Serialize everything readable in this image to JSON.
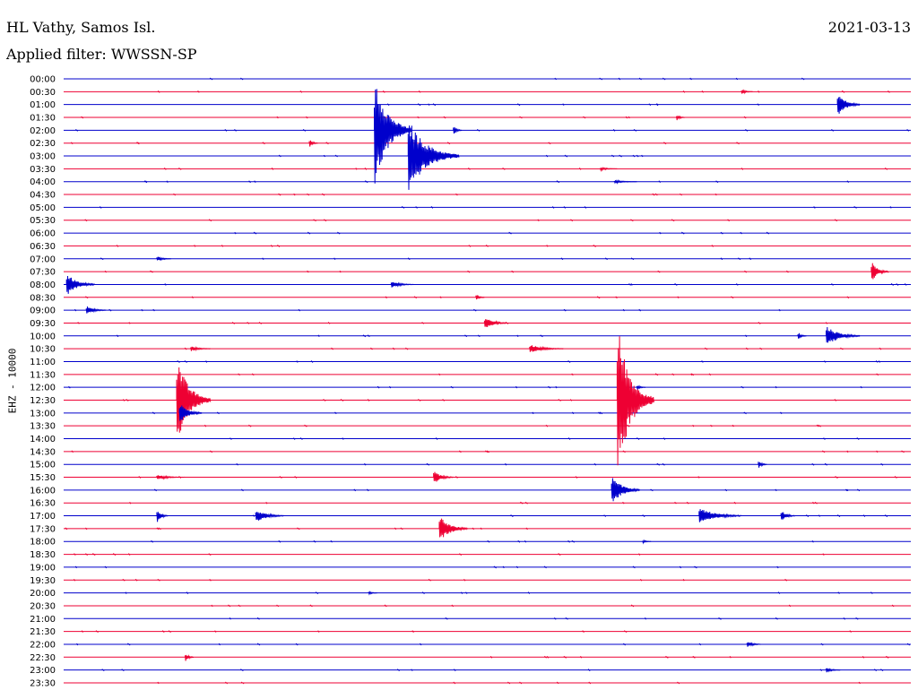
{
  "header": {
    "station": "HL Vathy, Samos Isl.",
    "date": "2021-03-13",
    "filter": "Applied filter: WWSSN-SP"
  },
  "chart_data": {
    "type": "line",
    "title": "HL Vathy, Samos Isl.",
    "subtitle": "Applied filter: WWSSN-SP",
    "ylabel": "EHZ - 10000",
    "trace_colors": [
      "#0000cc",
      "#ee0033"
    ],
    "row_times": [
      "00:00",
      "00:30",
      "01:00",
      "01:30",
      "02:00",
      "02:30",
      "03:00",
      "03:30",
      "04:00",
      "04:30",
      "05:00",
      "05:30",
      "06:00",
      "06:30",
      "07:00",
      "07:30",
      "08:00",
      "08:30",
      "09:00",
      "09:30",
      "10:00",
      "10:30",
      "11:00",
      "11:30",
      "12:00",
      "12:30",
      "13:00",
      "13:30",
      "14:00",
      "14:30",
      "15:00",
      "15:30",
      "16:00",
      "16:30",
      "17:00",
      "17:30",
      "18:00",
      "18:30",
      "19:00",
      "19:30",
      "20:00",
      "20:30",
      "21:00",
      "21:30",
      "22:00",
      "22:30",
      "23:00",
      "23:30"
    ],
    "x_minutes_range": [
      0,
      30
    ],
    "events": [
      {
        "row": 1,
        "minute": 24.0,
        "amp": 3,
        "dur": 0.4
      },
      {
        "row": 2,
        "minute": 27.4,
        "amp": 14,
        "dur": 0.8
      },
      {
        "row": 3,
        "minute": 21.7,
        "amp": 4,
        "dur": 0.3
      },
      {
        "row": 4,
        "minute": 11.0,
        "amp": 67,
        "dur": 1.3
      },
      {
        "row": 4,
        "minute": 13.8,
        "amp": 6,
        "dur": 0.3
      },
      {
        "row": 5,
        "minute": 8.7,
        "amp": 5,
        "dur": 0.3
      },
      {
        "row": 6,
        "minute": 12.2,
        "amp": 43,
        "dur": 1.8
      },
      {
        "row": 7,
        "minute": 19.0,
        "amp": 2,
        "dur": 0.6
      },
      {
        "row": 8,
        "minute": 19.5,
        "amp": 2,
        "dur": 0.8
      },
      {
        "row": 14,
        "minute": 3.3,
        "amp": 3,
        "dur": 0.5
      },
      {
        "row": 15,
        "minute": 28.6,
        "amp": 12,
        "dur": 0.6
      },
      {
        "row": 16,
        "minute": 0.1,
        "amp": 13,
        "dur": 1.0
      },
      {
        "row": 16,
        "minute": 11.6,
        "amp": 4,
        "dur": 0.8
      },
      {
        "row": 17,
        "minute": 14.6,
        "amp": 4,
        "dur": 0.3
      },
      {
        "row": 18,
        "minute": 0.8,
        "amp": 5,
        "dur": 0.7
      },
      {
        "row": 19,
        "minute": 14.9,
        "amp": 8,
        "dur": 0.8
      },
      {
        "row": 20,
        "minute": 27.0,
        "amp": 12,
        "dur": 1.2
      },
      {
        "row": 20,
        "minute": 26.0,
        "amp": 5,
        "dur": 0.3
      },
      {
        "row": 21,
        "minute": 4.5,
        "amp": 3,
        "dur": 0.7
      },
      {
        "row": 21,
        "minute": 16.5,
        "amp": 5,
        "dur": 1.2
      },
      {
        "row": 25,
        "minute": 4.0,
        "amp": 52,
        "dur": 1.2
      },
      {
        "row": 25,
        "minute": 19.6,
        "amp": 90,
        "dur": 1.3
      },
      {
        "row": 24,
        "minute": 20.3,
        "amp": 3,
        "dur": 0.3
      },
      {
        "row": 26,
        "minute": 4.1,
        "amp": 12,
        "dur": 0.8
      },
      {
        "row": 30,
        "minute": 24.6,
        "amp": 5,
        "dur": 0.3
      },
      {
        "row": 31,
        "minute": 13.1,
        "amp": 8,
        "dur": 0.7
      },
      {
        "row": 31,
        "minute": 3.3,
        "amp": 3,
        "dur": 1.0
      },
      {
        "row": 32,
        "minute": 19.4,
        "amp": 18,
        "dur": 1.0
      },
      {
        "row": 34,
        "minute": 3.3,
        "amp": 9,
        "dur": 0.4
      },
      {
        "row": 34,
        "minute": 6.8,
        "amp": 8,
        "dur": 1.0
      },
      {
        "row": 34,
        "minute": 22.5,
        "amp": 10,
        "dur": 1.5
      },
      {
        "row": 34,
        "minute": 25.4,
        "amp": 7,
        "dur": 0.5
      },
      {
        "row": 35,
        "minute": 13.3,
        "amp": 16,
        "dur": 1.0
      },
      {
        "row": 36,
        "minute": 20.5,
        "amp": 2,
        "dur": 0.3
      },
      {
        "row": 40,
        "minute": 10.8,
        "amp": 2,
        "dur": 0.3
      },
      {
        "row": 44,
        "minute": 24.2,
        "amp": 4,
        "dur": 0.5
      },
      {
        "row": 45,
        "minute": 4.3,
        "amp": 6,
        "dur": 0.3
      },
      {
        "row": 46,
        "minute": 27.0,
        "amp": 3,
        "dur": 0.5
      }
    ],
    "grid": false,
    "legend": "none"
  }
}
